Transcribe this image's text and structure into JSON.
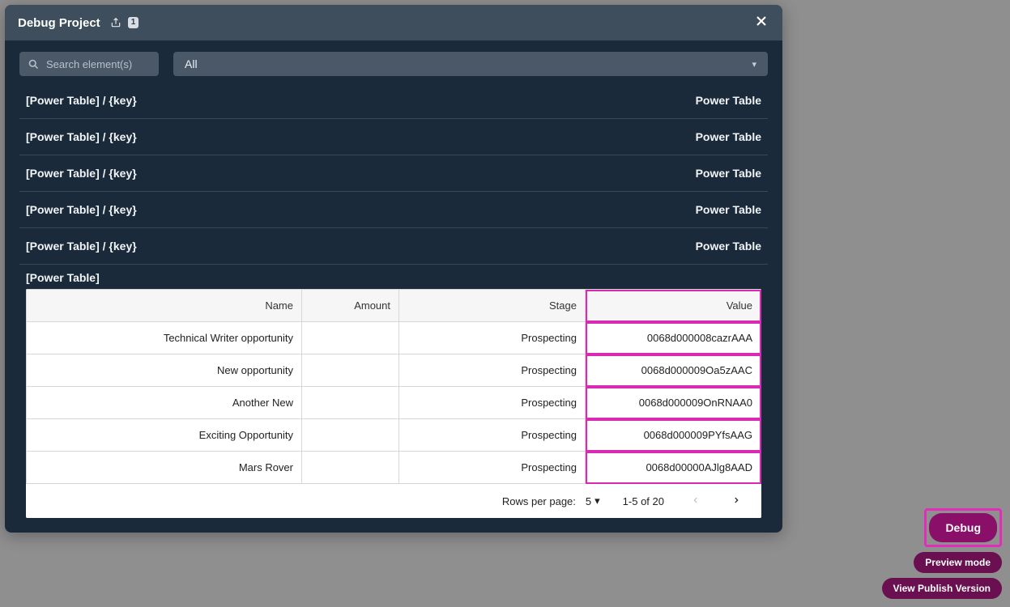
{
  "modal": {
    "title": "Debug Project",
    "share_count": "1",
    "search_placeholder": "Search element(s)",
    "filter_value": "All"
  },
  "rows": [
    {
      "label": "[Power Table] / {key}",
      "type": "Power Table"
    },
    {
      "label": "[Power Table] / {key}",
      "type": "Power Table"
    },
    {
      "label": "[Power Table] / {key}",
      "type": "Power Table"
    },
    {
      "label": "[Power Table] / {key}",
      "type": "Power Table"
    },
    {
      "label": "[Power Table] / {key}",
      "type": "Power Table"
    }
  ],
  "table": {
    "title": "[Power Table]",
    "columns": [
      "Name",
      "Amount",
      "Stage",
      "Value"
    ],
    "data": [
      {
        "name": "Technical Writer opportunity",
        "amount": "",
        "stage": "Prospecting",
        "value": "0068d000008cazrAAA"
      },
      {
        "name": "New opportunity",
        "amount": "",
        "stage": "Prospecting",
        "value": "0068d000009Oa5zAAC"
      },
      {
        "name": "Another New",
        "amount": "",
        "stage": "Prospecting",
        "value": "0068d000009OnRNAA0"
      },
      {
        "name": "Exciting Opportunity",
        "amount": "",
        "stage": "Prospecting",
        "value": "0068d000009PYfsAAG"
      },
      {
        "name": "Mars Rover",
        "amount": "",
        "stage": "Prospecting",
        "value": "0068d00000AJlg8AAD"
      }
    ],
    "footer": {
      "rows_per_page_label": "Rows per page:",
      "rows_per_page_value": "5",
      "range": "1-5 of 20"
    }
  },
  "float": {
    "debug": "Debug",
    "preview": "Preview mode",
    "view": "View Publish Version"
  }
}
